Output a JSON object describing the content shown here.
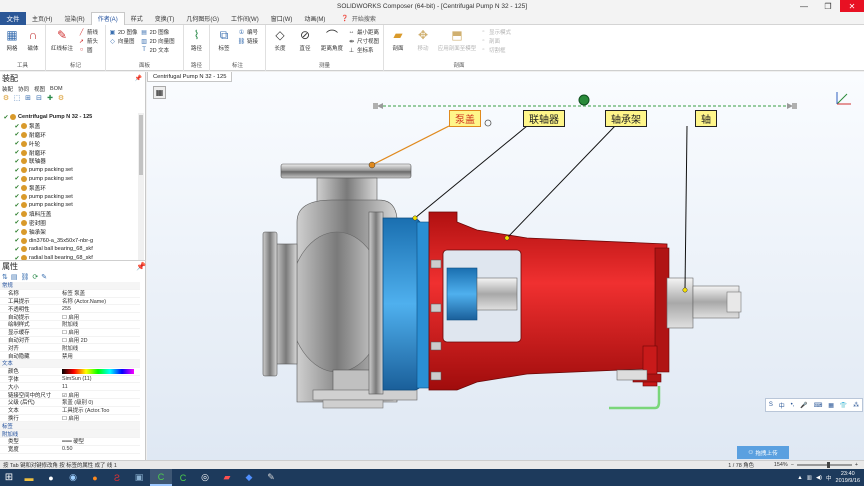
{
  "app": {
    "title": "SOLIDWORKS Composer (64-bit) - [Centrifugal Pump N 32 - 125]",
    "minimize": "—",
    "maximize": "❐",
    "close": "✕"
  },
  "menu": {
    "file": "文件",
    "tabs": [
      "主页(H)",
      "渲染(R)",
      "作者(A)",
      "样式",
      "变换(T)",
      "几何图形(G)",
      "工作间(W)",
      "窗口(W)",
      "动画(M)"
    ],
    "active_index": 2,
    "search": "开始搜索"
  },
  "ribbon": {
    "groups": [
      {
        "label": "工具",
        "big": [
          "网格",
          "磁体"
        ]
      },
      {
        "label": "标记",
        "big": [
          "红线标注"
        ],
        "small": [
          "箭线",
          "箭头",
          "圆"
        ]
      },
      {
        "label": "面板",
        "small": [
          "2D 图像",
          "向量图",
          "2D 图像",
          "2D 向量图",
          "2D 文本"
        ]
      },
      {
        "label": "路径",
        "big": [
          "路径"
        ]
      },
      {
        "label": "标注",
        "big": [
          "标签"
        ],
        "small": [
          "编号",
          "链接"
        ]
      },
      {
        "label": "测量",
        "big": [
          "长度",
          "直径",
          "距离角度"
        ],
        "small": [
          "最小距离",
          "尺寸视图",
          "坐标系"
        ]
      },
      {
        "label": "剖面",
        "big": [
          "剖面",
          "移动"
        ],
        "small": [
          "应用剖面至模型"
        ],
        "small2": [
          "显示模式",
          "剖面",
          "切割框"
        ]
      }
    ]
  },
  "assembly": {
    "title": "装配",
    "subtabs": [
      "装配",
      "协同",
      "视图",
      "BOM"
    ],
    "tree": [
      {
        "label": "Centrifugal Pump N 32 - 125",
        "root": true
      },
      {
        "label": "泵盖"
      },
      {
        "label": "耐磨环"
      },
      {
        "label": "叶轮"
      },
      {
        "label": "耐磨环"
      },
      {
        "label": "联轴器"
      },
      {
        "label": "pump packing set"
      },
      {
        "label": "pump packing set"
      },
      {
        "label": "泵盖环"
      },
      {
        "label": "pump packing set"
      },
      {
        "label": "pump packing set"
      },
      {
        "label": "填料压盖"
      },
      {
        "label": "密封圈"
      },
      {
        "label": "轴承架"
      },
      {
        "label": "din3760-a_35x50x7-nbr-g"
      },
      {
        "label": "radial ball bearing_68_skf"
      },
      {
        "label": "radial ball bearing_68_skf"
      }
    ]
  },
  "properties": {
    "title": "属性",
    "rows": [
      {
        "k": "常规",
        "v": "",
        "section": true
      },
      {
        "k": "名称",
        "v": "标签 泵盖"
      },
      {
        "k": "工具提示",
        "v": "名称 (Actor.Name)"
      },
      {
        "k": "不透明性",
        "v": "255"
      },
      {
        "k": "自动提示",
        "v": "☐ 启用"
      },
      {
        "k": "绘制样式",
        "v": "附加线"
      },
      {
        "k": "显示缓存",
        "v": "☐ 启用"
      },
      {
        "k": "自动对齐",
        "v": "☐ 启用 2D"
      },
      {
        "k": "对齐",
        "v": "附加线"
      },
      {
        "k": "自动隐藏",
        "v": "禁用"
      },
      {
        "k": "文本",
        "v": "",
        "section": true
      },
      {
        "k": "颜色",
        "v": ""
      },
      {
        "k": "字体",
        "v": "SimSun (11)"
      },
      {
        "k": "大小",
        "v": "11"
      },
      {
        "k": "链接空间中的尺寸",
        "v": "☑ 启用"
      },
      {
        "k": "父级 (后代)",
        "v": "泵盖 (级别 0)"
      },
      {
        "k": "文本",
        "v": "工具提示 (Actor.Too"
      },
      {
        "k": "换行",
        "v": "☐ 启用"
      },
      {
        "k": "标签",
        "v": "",
        "section": true
      },
      {
        "k": "附加线",
        "v": "",
        "section": true
      },
      {
        "k": "类型",
        "v": "━━━ 硬型"
      },
      {
        "k": "宽度",
        "v": "0.50"
      }
    ]
  },
  "viewport": {
    "doc_tab": "Centrifugal Pump N 32 - 125",
    "callouts": [
      {
        "id": "pump-cover",
        "text": "泵盖"
      },
      {
        "id": "coupling",
        "text": "联轴器"
      },
      {
        "id": "bearing-frame",
        "text": "轴承架"
      },
      {
        "id": "shaft",
        "text": "轴"
      }
    ],
    "mini_toolbar": [
      "S",
      "中",
      "•,",
      "🎤",
      "⌨",
      "▦",
      "👕",
      "⁂"
    ],
    "upload": "拖拽上传"
  },
  "status": {
    "hint": "按 Tab 键和对键修改角 按 标签的属性 成了 线 1",
    "page": "1 / 78 角色",
    "zoom": "154%"
  },
  "taskbar": {
    "time": "23:40",
    "date": "2019/9/16",
    "lang": "中"
  },
  "colors": {
    "accent": "#2b5797",
    "casing_red": "#e02020",
    "casing_blue": "#2a8fd4"
  }
}
